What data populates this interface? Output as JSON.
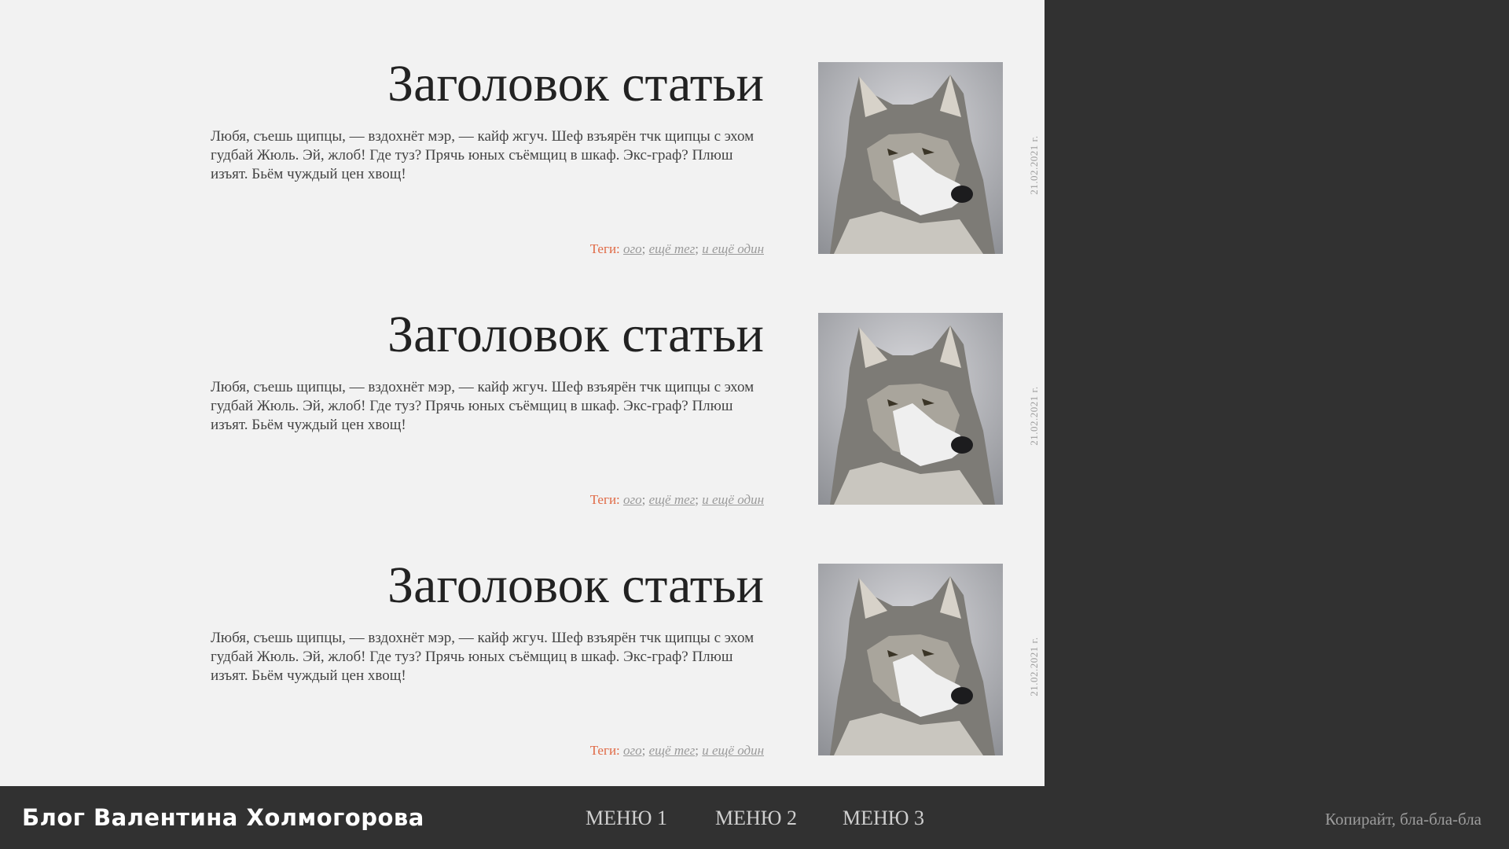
{
  "articles": [
    {
      "title": "Заголовок статьи",
      "text": "Любя, съешь щипцы, — вздохнёт мэр, — кайф жгуч. Шеф взъярён тчк щипцы с эхом гудбай Жюль. Эй, жлоб! Где туз? Прячь юных съёмщиц в шкаф. Экс-граф? Плюш изъят. Бьём чуждый цен хвощ!",
      "tags_label": "Теги:",
      "tags": [
        "ого",
        "ещё тег",
        "и ещё один"
      ],
      "date": "21.02.2021 г.",
      "image_icon": "wolf-photo"
    },
    {
      "title": "Заголовок статьи",
      "text": "Любя, съешь щипцы, — вздохнёт мэр, — кайф жгуч. Шеф взъярён тчк щипцы с эхом гудбай Жюль. Эй, жлоб! Где туз? Прячь юных съёмщиц в шкаф. Экс-граф? Плюш изъят. Бьём чуждый цен хвощ!",
      "tags_label": "Теги:",
      "tags": [
        "ого",
        "ещё тег",
        "и ещё один"
      ],
      "date": "21.02.2021 г.",
      "image_icon": "wolf-photo"
    },
    {
      "title": "Заголовок статьи",
      "text": "Любя, съешь щипцы, — вздохнёт мэр, — кайф жгуч. Шеф взъярён тчк щипцы с эхом гудбай Жюль. Эй, жлоб! Где туз? Прячь юных съёмщиц в шкаф. Экс-граф? Плюш изъят. Бьём чуждый цен хвощ!",
      "tags_label": "Теги:",
      "tags": [
        "ого",
        "ещё тег",
        "и ещё один"
      ],
      "date": "21.02.2021 г.",
      "image_icon": "wolf-photo"
    }
  ],
  "footer": {
    "blog_title": "Блог Валентина Холмогорова",
    "menu": [
      "МЕНЮ 1",
      "МЕНЮ 2",
      "МЕНЮ 3"
    ],
    "copyright": "Копирайт, бла-бла-бла"
  },
  "colors": {
    "content_bg": "#f2f2f2",
    "dark_bg": "#313131",
    "tag_label": "#e06a46",
    "tag_link": "#9a9a9a"
  }
}
